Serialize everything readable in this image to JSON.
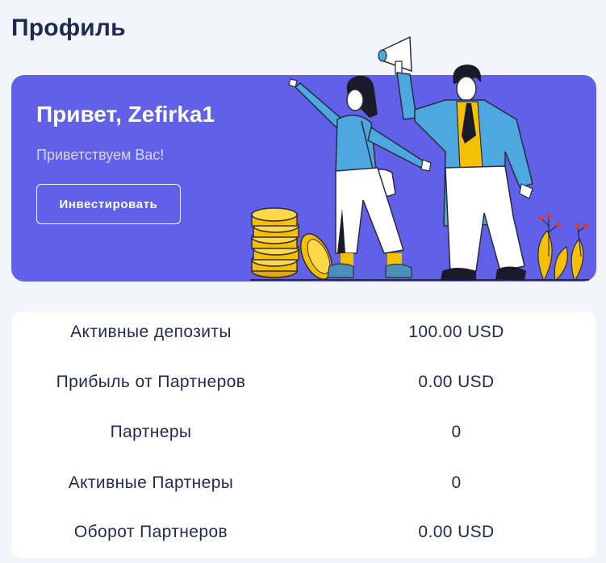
{
  "page": {
    "title": "Профиль"
  },
  "hero": {
    "greeting": "Привет, Zefirka1",
    "subtitle": "Приветствуем Вас!",
    "invest_label": "Инвестировать",
    "background_color": "#6060e8"
  },
  "stats": [
    {
      "label": "Активные депозиты",
      "value": "100.00 USD"
    },
    {
      "label": "Прибыль от Партнеров",
      "value": "0.00 USD"
    },
    {
      "label": "Партнеры",
      "value": "0"
    },
    {
      "label": "Активные Партнеры",
      "value": "0"
    },
    {
      "label": "Оборот Партнеров",
      "value": "0.00 USD"
    }
  ],
  "colors": {
    "text_dark": "#1e2b4f",
    "page_bg": "#f2f5fb",
    "accent": "#6060e8",
    "coin": "#f5c000"
  }
}
